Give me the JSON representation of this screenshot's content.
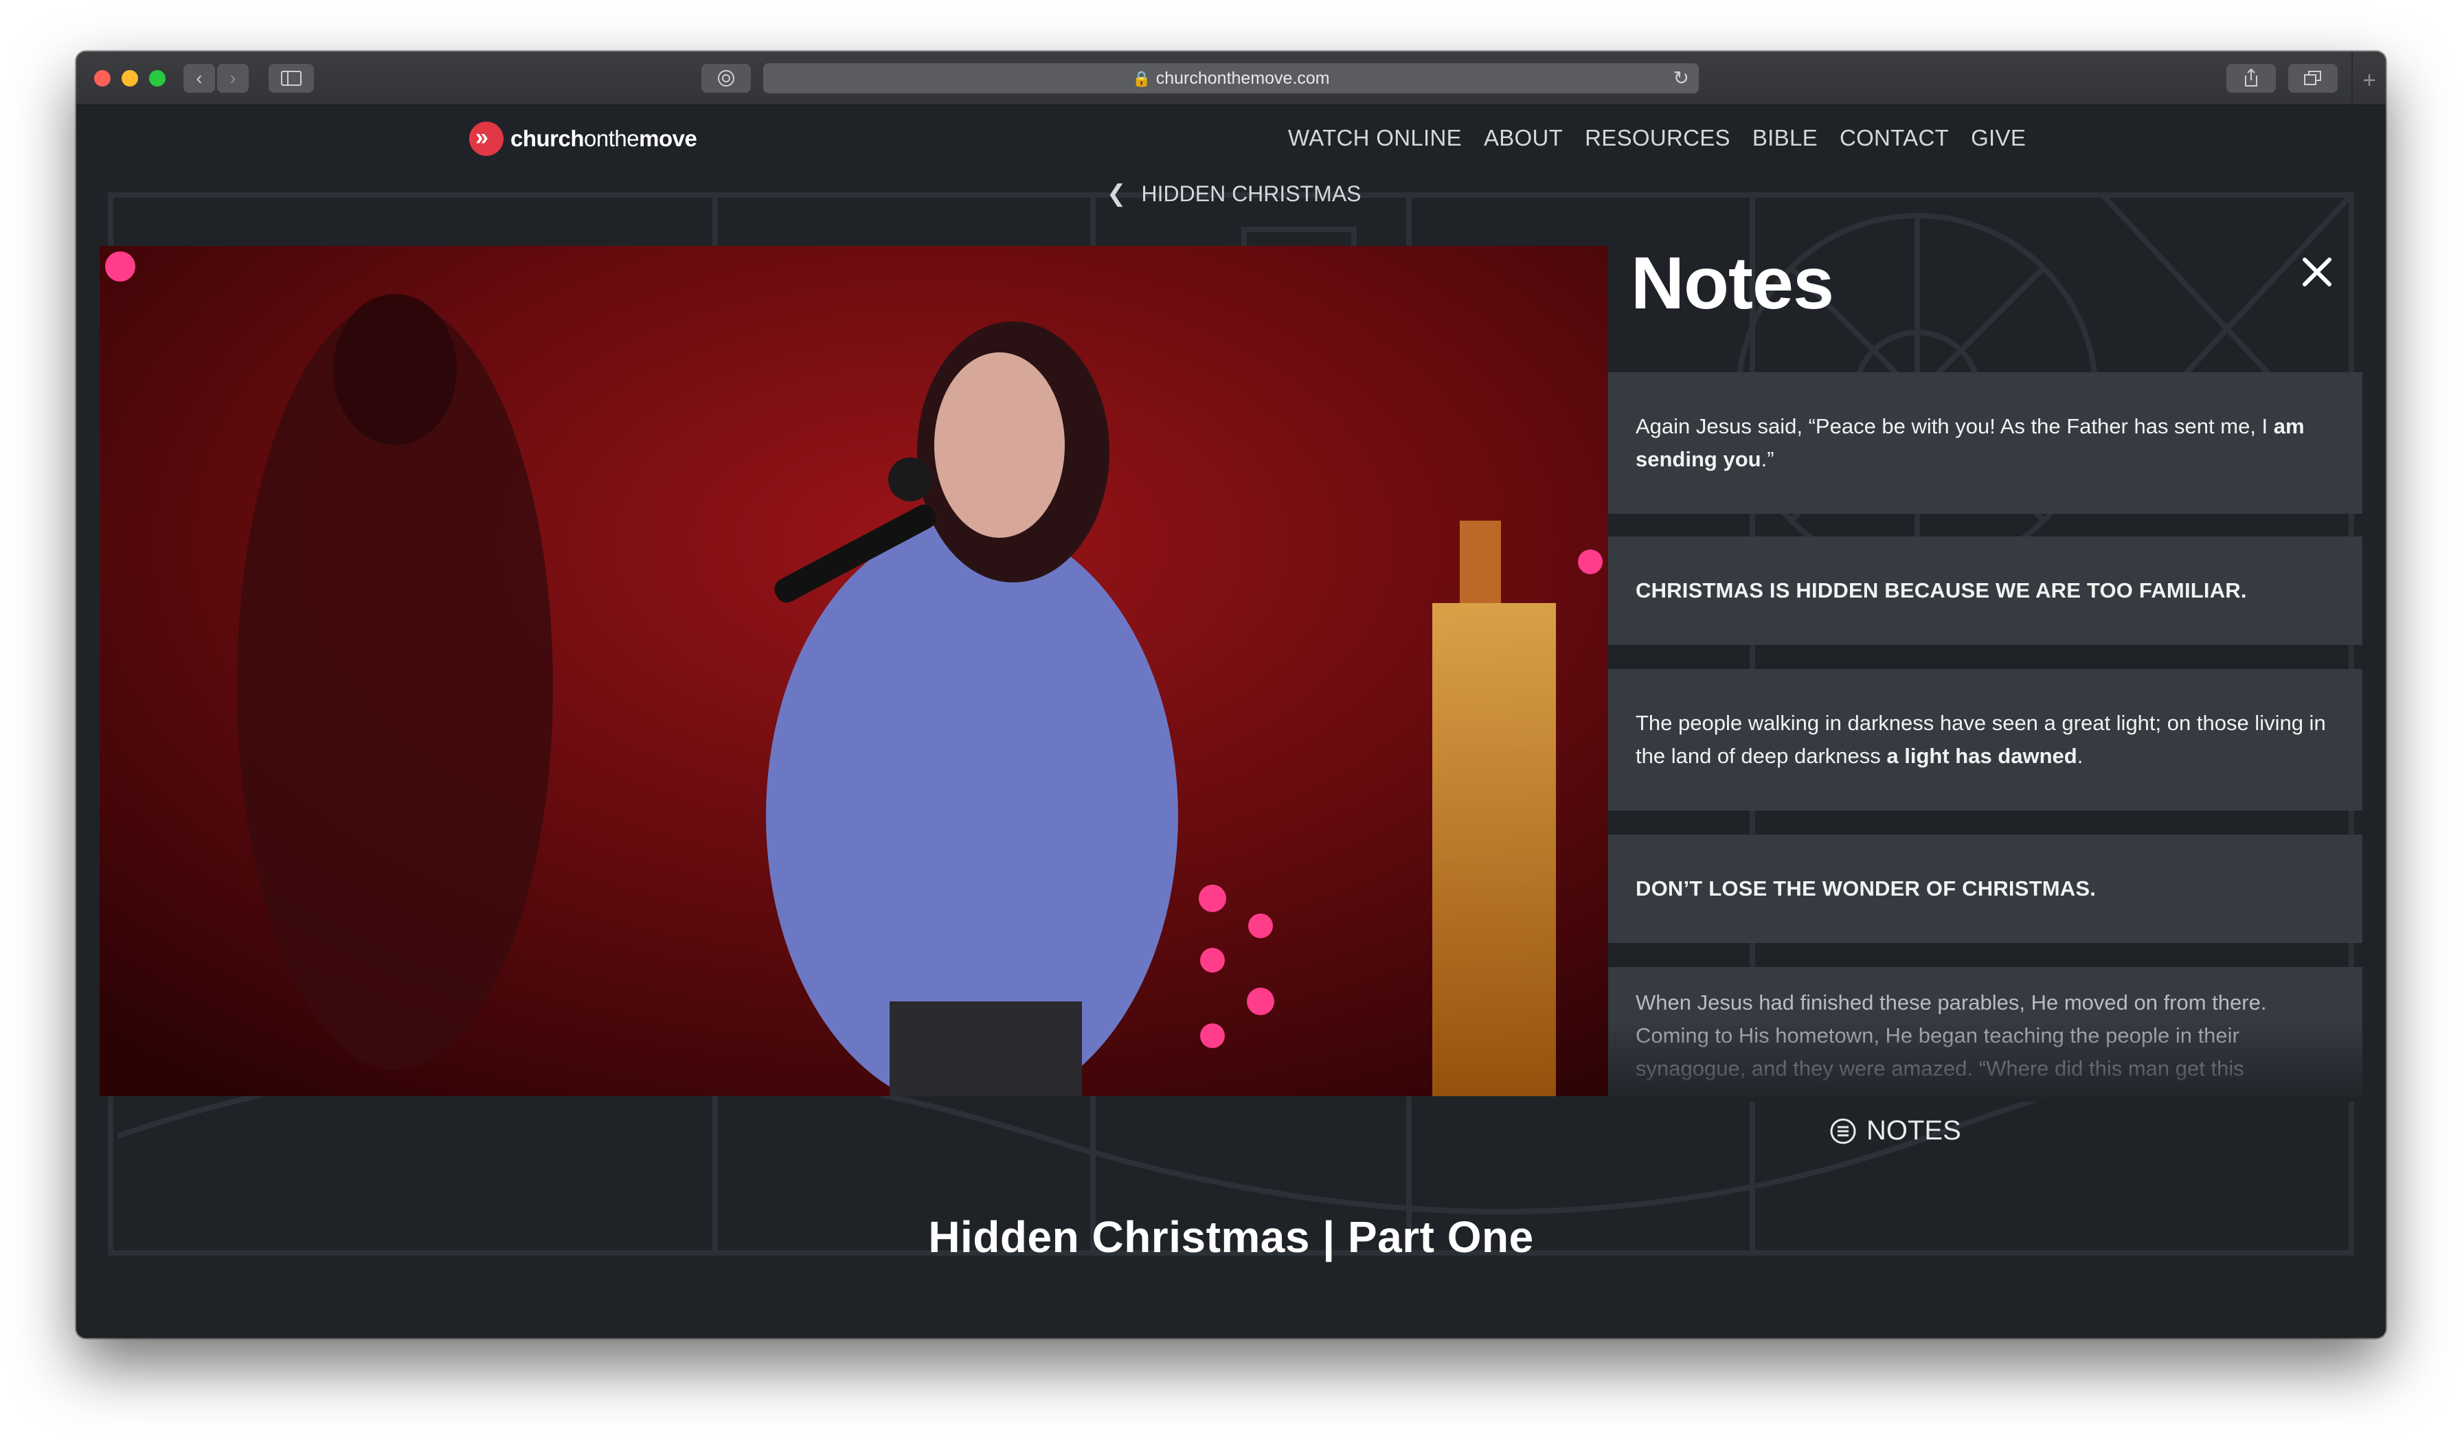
{
  "browser": {
    "url": "churchonthemove.com"
  },
  "site": {
    "logo_prefix": "church",
    "logo_middle": "onthe",
    "logo_suffix": "move"
  },
  "nav": {
    "items": [
      "WATCH ONLINE",
      "ABOUT",
      "RESOURCES",
      "BIBLE",
      "CONTACT",
      "GIVE"
    ]
  },
  "breadcrumb": {
    "label": "HIDDEN CHRISTMAS"
  },
  "notes": {
    "title": "Notes",
    "card1_text": "Again Jesus said, “Peace be with you! As the Father has sent me, I ",
    "card1_bold": "am sending you",
    "card1_end": ".”",
    "card2": "CHRISTMAS IS HIDDEN BECAUSE WE ARE TOO FAMILIAR.",
    "card3_text": "The people walking in darkness have seen a great light; on those living in the land of deep darkness ",
    "card3_bold": "a light has dawned",
    "card3_end": ".",
    "card4": "DON’T LOSE THE WONDER OF CHRISTMAS.",
    "card5": "When Jesus had finished these parables, He moved on from there. Coming to His hometown, He began teaching the people in their synagogue, and they were amazed. “Where did this man get this"
  },
  "notes_toggle": {
    "label": "NOTES"
  },
  "page": {
    "title": "Hidden Christmas | Part One"
  },
  "colors": {
    "brand_red": "#e23744",
    "page_bg": "#1f2328",
    "card_bg": "#363b41"
  }
}
